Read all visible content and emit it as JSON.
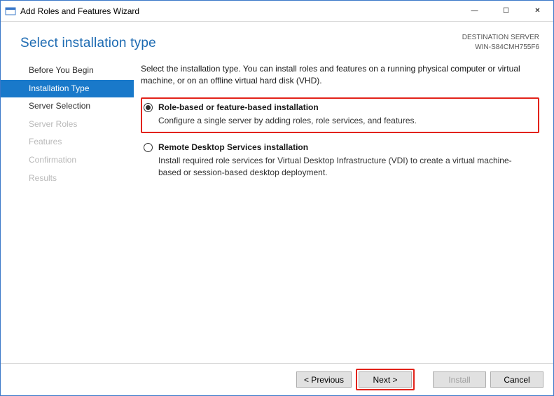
{
  "window": {
    "title": "Add Roles and Features Wizard"
  },
  "header": {
    "page_title": "Select installation type",
    "destination_label": "DESTINATION SERVER",
    "destination_value": "WIN-S84CMH755F6"
  },
  "sidebar": {
    "items": [
      {
        "label": "Before You Begin",
        "state": "enabled"
      },
      {
        "label": "Installation Type",
        "state": "active"
      },
      {
        "label": "Server Selection",
        "state": "enabled"
      },
      {
        "label": "Server Roles",
        "state": "disabled"
      },
      {
        "label": "Features",
        "state": "disabled"
      },
      {
        "label": "Confirmation",
        "state": "disabled"
      },
      {
        "label": "Results",
        "state": "disabled"
      }
    ]
  },
  "content": {
    "intro": "Select the installation type. You can install roles and features on a running physical computer or virtual machine, or on an offline virtual hard disk (VHD).",
    "options": [
      {
        "title": "Role-based or feature-based installation",
        "desc": "Configure a single server by adding roles, role services, and features.",
        "checked": true,
        "highlight": true
      },
      {
        "title": "Remote Desktop Services installation",
        "desc": "Install required role services for Virtual Desktop Infrastructure (VDI) to create a virtual machine-based or session-based desktop deployment.",
        "checked": false,
        "highlight": false
      }
    ]
  },
  "footer": {
    "previous": "< Previous",
    "next": "Next >",
    "install": "Install",
    "cancel": "Cancel",
    "next_highlight": true
  },
  "icons": {
    "minimize": "—",
    "maximize": "☐",
    "close": "✕"
  }
}
